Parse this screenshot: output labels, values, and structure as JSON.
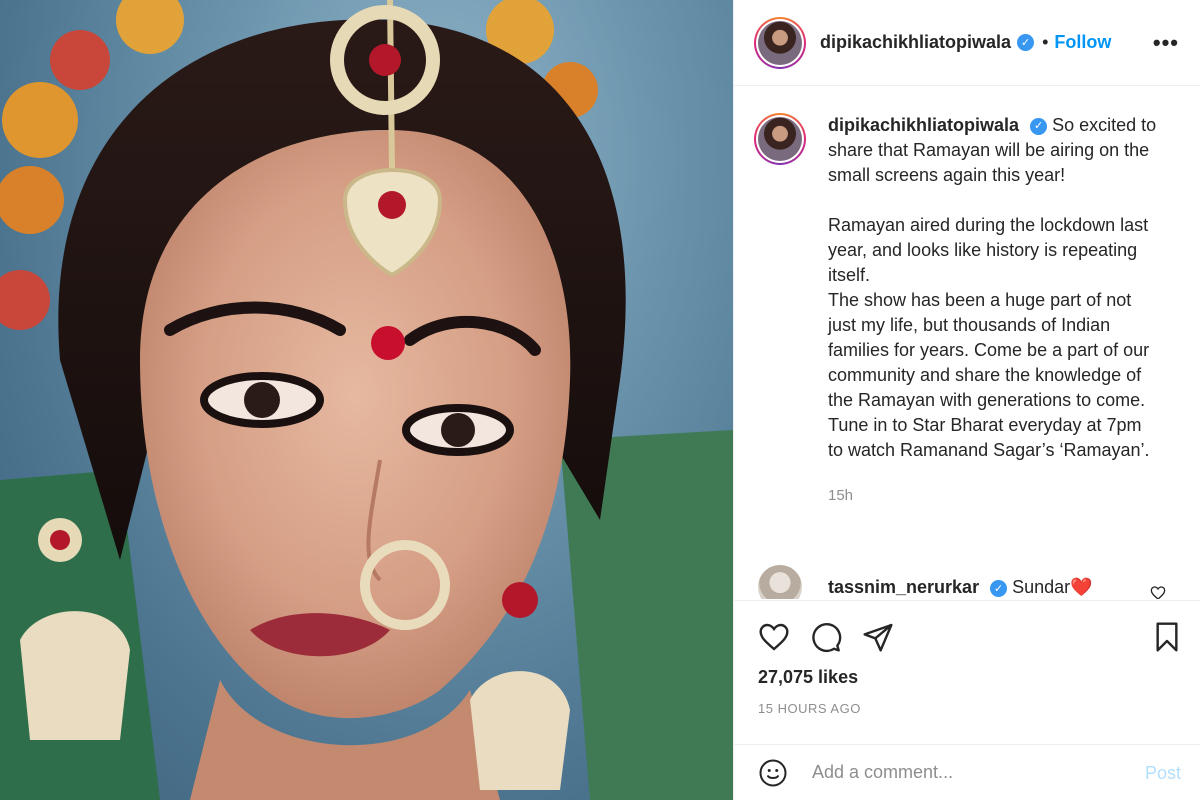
{
  "post": {
    "image_alt": "Actress in traditional bridal jewellery with maang tikka, bindi and nath"
  },
  "header": {
    "username": "dipikachikhliatopiwala",
    "verified_mark": "✓",
    "separator": "•",
    "follow_label": "Follow",
    "more_label": "•••"
  },
  "caption": {
    "username": "dipikachikhliatopiwala",
    "verified_mark": "✓",
    "line1": "So excited to share that Ramayan will be airing on the small screens again this year!",
    "line2": "Ramayan aired during the lockdown last year, and looks like history is repeating itself.",
    "line3": "The show has been a huge part of not just my life, but thousands of Indian families for years. Come be a part of our community and share the knowledge of the Ramayan with generations to come. Tune in to Star Bharat everyday at 7pm to watch Ramanand Sagar’s ‘Ramayan’.",
    "age": "15h"
  },
  "comments": [
    {
      "username": "tassnim_nerurkar",
      "verified_mark": "✓",
      "text": "Sundar❤️"
    }
  ],
  "actions": {
    "likes": "27,075 likes",
    "timestamp": "15 HOURS AGO"
  },
  "add_comment": {
    "placeholder": "Add a comment...",
    "post_label": "Post"
  },
  "colors": {
    "accent": "#0095f6",
    "post_disabled": "#b2dffc",
    "verified": "#3897f0",
    "muted": "#8e8e8e"
  }
}
